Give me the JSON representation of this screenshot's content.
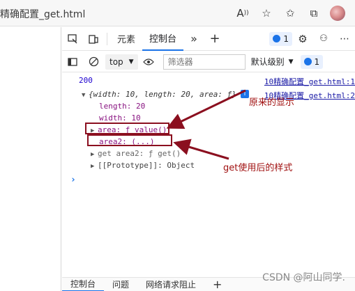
{
  "browser": {
    "url_text": "精确配置_get.html",
    "icons": [
      "read-aloud-icon",
      "favorite-add-icon",
      "favorites-icon",
      "collections-icon",
      "profile-avatar"
    ]
  },
  "devtools": {
    "tabs": [
      "元素",
      "控制台"
    ],
    "active_tab": "控制台",
    "issues_badge": "1",
    "toolbar": {
      "context": "top",
      "filter_placeholder": "筛选器",
      "level": "默认级别",
      "issues_badge": "1"
    },
    "console": {
      "lines": [
        {
          "text": "200",
          "source": "10精确配置_get.html:1"
        },
        {
          "text": "{width: 10, length: 20, area: ƒ}",
          "source": "10精确配置_get.html:2"
        },
        {
          "text": "length: 20"
        },
        {
          "text": "width: 10"
        },
        {
          "text": "area: ƒ value()"
        },
        {
          "text": "area2: (...)"
        },
        {
          "text": "get area2: ƒ get()"
        },
        {
          "text": "[[Prototype]]: Object"
        }
      ]
    },
    "drawer_tabs": [
      "控制台",
      "问题",
      "网络请求阻止"
    ]
  },
  "annotations": {
    "original": "原来的显示",
    "after_get": "get使用后的样式"
  },
  "watermark": "CSDN @阿山同学.",
  "colors": {
    "annotation": "#8b0f1f",
    "accent": "#1a73e8"
  }
}
